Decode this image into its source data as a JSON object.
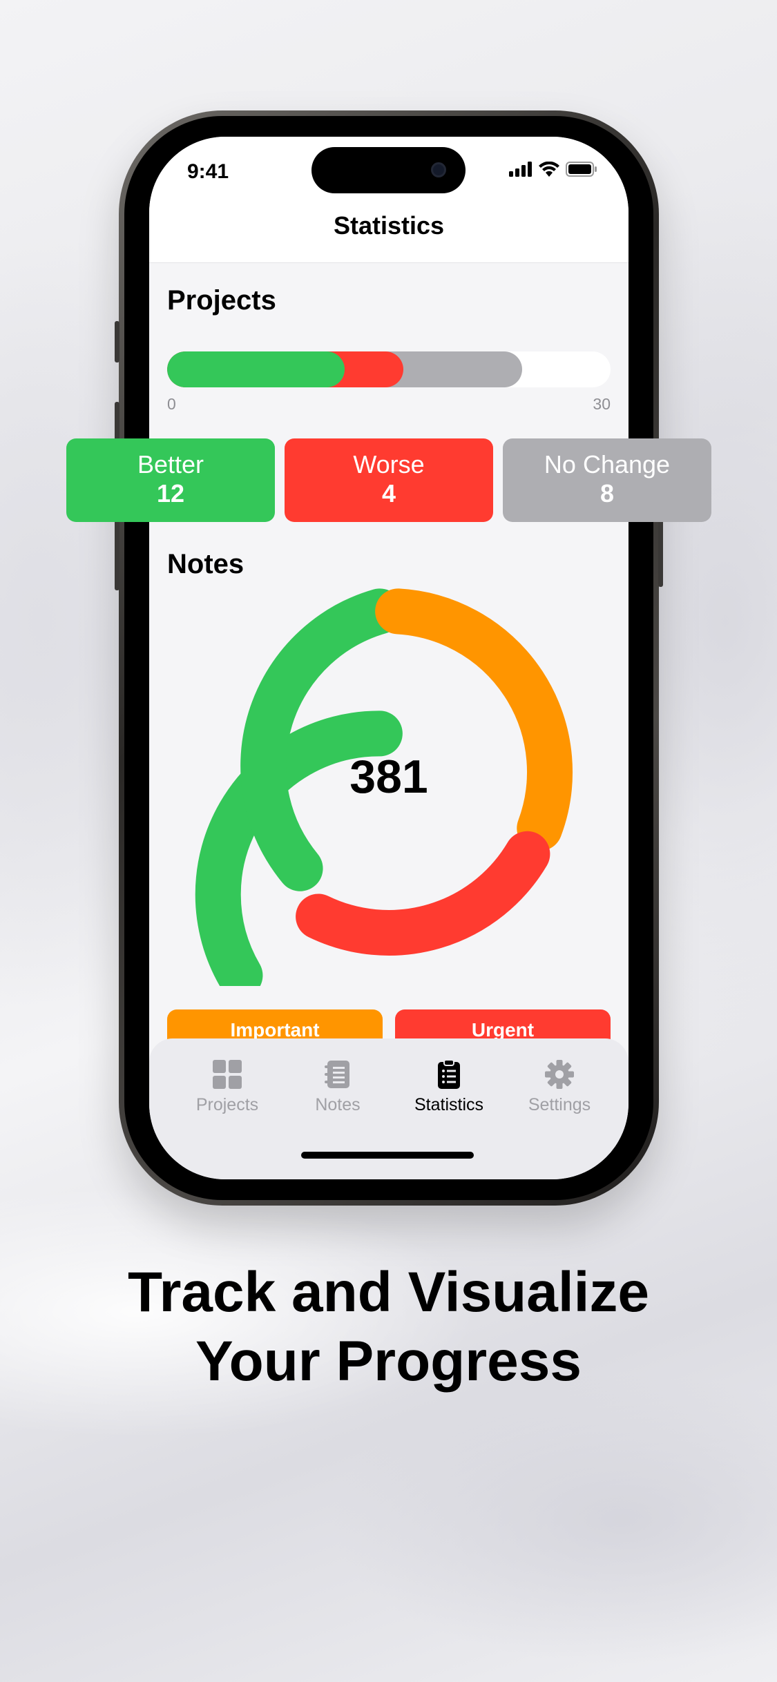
{
  "status_bar": {
    "time": "9:41"
  },
  "header": {
    "title": "Statistics"
  },
  "projects": {
    "section_title": "Projects",
    "range_min": "0",
    "range_max": "30",
    "bar": {
      "total": 30,
      "better": 12,
      "worse": 4,
      "no_change": 8
    },
    "cards": [
      {
        "label": "Better",
        "value": "12",
        "color": "#34C759"
      },
      {
        "label": "Worse",
        "value": "4",
        "color": "#FF3B30"
      },
      {
        "label": "No Change",
        "value": "8",
        "color": "#AEAEB2"
      }
    ]
  },
  "notes": {
    "section_title": "Notes",
    "total": "381",
    "ring_colors": {
      "green": "#34C759",
      "orange": "#FF9500",
      "red": "#FF3B30"
    },
    "cards": [
      {
        "label": "Important",
        "color": "#FF9500"
      },
      {
        "label": "Urgent",
        "color": "#FF3B30"
      }
    ]
  },
  "tab_bar": {
    "tabs": [
      {
        "label": "Projects",
        "icon": "grid-icon"
      },
      {
        "label": "Notes",
        "icon": "notebook-icon"
      },
      {
        "label": "Statistics",
        "icon": "clipboard-icon",
        "active": true
      },
      {
        "label": "Settings",
        "icon": "gear-icon"
      }
    ]
  },
  "marketing": {
    "headline_line1": "Track and Visualize",
    "headline_line2": "Your Progress"
  }
}
